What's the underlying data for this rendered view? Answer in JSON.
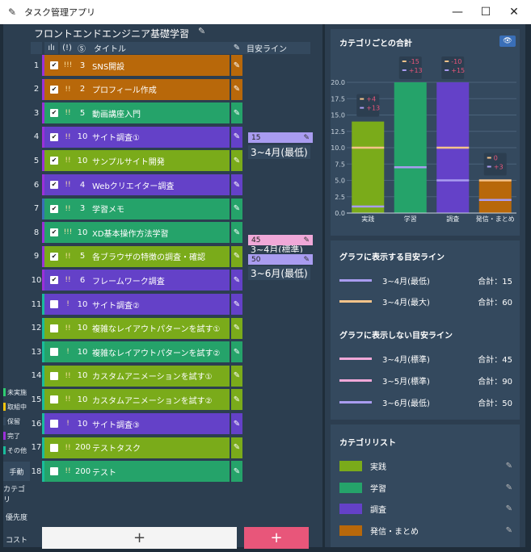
{
  "window": {
    "title": "タスク管理アプリ",
    "icon": "pen-icon",
    "controls": {
      "minimize": "—",
      "maximize": "☐",
      "close": "✕"
    }
  },
  "sidebar": {
    "statuses": [
      {
        "label": "未実施",
        "color": "#2ecc71"
      },
      {
        "label": "取組中",
        "color": "#f1c40f"
      },
      {
        "label": "保留",
        "color": "#34495e"
      },
      {
        "label": "完了",
        "color": "#9b30d9"
      },
      {
        "label": "その他",
        "color": "#1abc9c"
      }
    ],
    "buttons": [
      {
        "label": "手動",
        "active": true
      },
      {
        "label": "カテゴリ",
        "active": false
      },
      {
        "label": "優先度",
        "active": false
      },
      {
        "label": "コスト",
        "active": false
      }
    ]
  },
  "project": {
    "title": "フロントエンドエンジニア基礎学習",
    "columns": {
      "chart": "ılı",
      "priority": "(!)",
      "cost": "Ⓢ",
      "title": "タイトル",
      "guideline": "目安ライン"
    }
  },
  "tasks": [
    {
      "n": "1",
      "done": true,
      "pri": "!!!",
      "cost": "3",
      "title": "SNS開設",
      "color": "#b8680a",
      "stripe": "#9b30d9"
    },
    {
      "n": "2",
      "done": true,
      "pri": "!!",
      "cost": "2",
      "title": "プロフィール作成",
      "color": "#b8680a",
      "stripe": "#9b30d9"
    },
    {
      "n": "3",
      "done": true,
      "pri": "!!",
      "cost": "5",
      "title": "動画講座入門",
      "color": "#25a36a",
      "stripe": "#9b30d9"
    },
    {
      "n": "4",
      "done": true,
      "pri": "!!",
      "cost": "10",
      "title": "サイト調査①",
      "color": "#6441c8",
      "stripe": "#9b30d9"
    },
    {
      "n": "5",
      "done": true,
      "pri": "!!",
      "cost": "10",
      "title": "サンプルサイト開発",
      "color": "#7aab1a",
      "stripe": "#9b30d9"
    },
    {
      "n": "6",
      "done": true,
      "pri": "!!",
      "cost": "4",
      "title": "Webクリエイター調査",
      "color": "#6441c8",
      "stripe": "#9b30d9"
    },
    {
      "n": "7",
      "done": true,
      "pri": "!!",
      "cost": "3",
      "title": "学習メモ",
      "color": "#25a36a",
      "stripe": "#3a6fb8"
    },
    {
      "n": "8",
      "done": true,
      "pri": "!!!",
      "cost": "10",
      "title": "XD基本操作方法学習",
      "color": "#25a36a",
      "stripe": "#9b30d9"
    },
    {
      "n": "9",
      "done": true,
      "pri": "!!",
      "cost": "5",
      "title": "各ブラウザの特徴の調査・確認",
      "color": "#7aab1a",
      "stripe": "#9b30d9"
    },
    {
      "n": "10",
      "done": true,
      "pri": "!!",
      "cost": "6",
      "title": "フレームワーク調査",
      "color": "#6441c8",
      "stripe": "#9b30d9"
    },
    {
      "n": "11",
      "done": false,
      "pri": "!",
      "cost": "10",
      "title": "サイト調査②",
      "color": "#6441c8",
      "stripe": "#1abc9c"
    },
    {
      "n": "12",
      "done": false,
      "pri": "!!",
      "cost": "10",
      "title": "複雑なレイアウトパターンを試す①",
      "color": "#7aab1a",
      "stripe": "#1abc9c"
    },
    {
      "n": "13",
      "done": false,
      "pri": "!",
      "cost": "10",
      "title": "複雑なレイアウトパターンを試す②",
      "color": "#25a36a",
      "stripe": "#1abc9c"
    },
    {
      "n": "14",
      "done": false,
      "pri": "!!",
      "cost": "10",
      "title": "カスタムアニメーションを試す①",
      "color": "#7aab1a",
      "stripe": "#1abc9c"
    },
    {
      "n": "15",
      "done": false,
      "pri": "!!",
      "cost": "10",
      "title": "カスタムアニメーションを試す②",
      "color": "#7aab1a",
      "stripe": "#1abc9c"
    },
    {
      "n": "16",
      "done": false,
      "pri": "!",
      "cost": "10",
      "title": "サイト調査③",
      "color": "#6441c8",
      "stripe": "#1abc9c"
    },
    {
      "n": "17",
      "done": false,
      "pri": "!!",
      "cost": "200",
      "title": "テストタスク",
      "color": "#7aab1a",
      "stripe": "#1abc9c"
    },
    {
      "n": "18",
      "done": false,
      "pri": "!!",
      "cost": "200",
      "title": "テスト",
      "color": "#25a36a",
      "stripe": "#1abc9c"
    }
  ],
  "guideline_markers": [
    {
      "value": "15",
      "color": "#a99cf0",
      "label": "3~4月(最低)"
    },
    {
      "value": "45",
      "color": "#f0a8d8",
      "label": ""
    },
    {
      "value": "50",
      "color": "#a99cf0",
      "label": "3~6月(最低)",
      "partial": "3~4月(標準)"
    }
  ],
  "buttons": {
    "add_gray": "+",
    "add_red": "+"
  },
  "chart_panel": {
    "title": "カテゴリごとの合計",
    "eye": "👁"
  },
  "chart_data": {
    "type": "bar",
    "categories": [
      "実践",
      "学習",
      "調査",
      "発信・まとめ"
    ],
    "values": [
      14,
      20,
      20,
      5
    ],
    "colors": [
      "#7aab1a",
      "#25a36a",
      "#6441c8",
      "#b8680a"
    ],
    "ylim": [
      0,
      20
    ],
    "yticks": [
      "0.0",
      "2.5",
      "5.0",
      "7.5",
      "10.0",
      "12.5",
      "15.0",
      "17.5",
      "20.0"
    ],
    "guideline_values": [
      {
        "name": "3~4月(最大)",
        "color": "#f5c38a",
        "values": [
          10,
          null,
          10,
          5
        ]
      },
      {
        "name": "3~4月(最低)",
        "color": "#a99cf0",
        "values": [
          1,
          7,
          5,
          2
        ]
      }
    ],
    "annotations": [
      {
        "cat": "実践",
        "lines": [
          {
            "dash": "#f5c38a",
            "text": "+4"
          },
          {
            "dash": "#a99cf0",
            "text": "+13"
          }
        ]
      },
      {
        "cat": "学習",
        "lines": [
          {
            "dash": "#f5c38a",
            "text": "-15"
          },
          {
            "dash": "#a99cf0",
            "text": "+13"
          }
        ]
      },
      {
        "cat": "調査",
        "lines": [
          {
            "dash": "#f5c38a",
            "text": "-10"
          },
          {
            "dash": "#a99cf0",
            "text": "+15"
          }
        ]
      },
      {
        "cat": "発信・まとめ",
        "lines": [
          {
            "dash": "#f5c38a",
            "text": "0"
          },
          {
            "dash": "#a99cf0",
            "text": "+3"
          }
        ]
      }
    ]
  },
  "shown_guidelines": {
    "title": "グラフに表示する目安ライン",
    "items": [
      {
        "name": "3~4月(最低)",
        "total": "合計：15",
        "color": "#a99cf0"
      },
      {
        "name": "3~4月(最大)",
        "total": "合計：60",
        "color": "#f5c38a"
      }
    ]
  },
  "hidden_guidelines": {
    "title": "グラフに表示しない目安ライン",
    "items": [
      {
        "name": "3~4月(標準)",
        "total": "合計：45",
        "color": "#f0a8d8"
      },
      {
        "name": "3~5月(標準)",
        "total": "合計：90",
        "color": "#f0a8d8"
      },
      {
        "name": "3~6月(最低)",
        "total": "合計：50",
        "color": "#a99cf0"
      }
    ]
  },
  "category_list": {
    "title": "カテゴリリスト",
    "items": [
      {
        "name": "実践",
        "color": "#7aab1a"
      },
      {
        "name": "学習",
        "color": "#25a36a"
      },
      {
        "name": "調査",
        "color": "#6441c8"
      },
      {
        "name": "発信・まとめ",
        "color": "#b8680a"
      }
    ]
  }
}
